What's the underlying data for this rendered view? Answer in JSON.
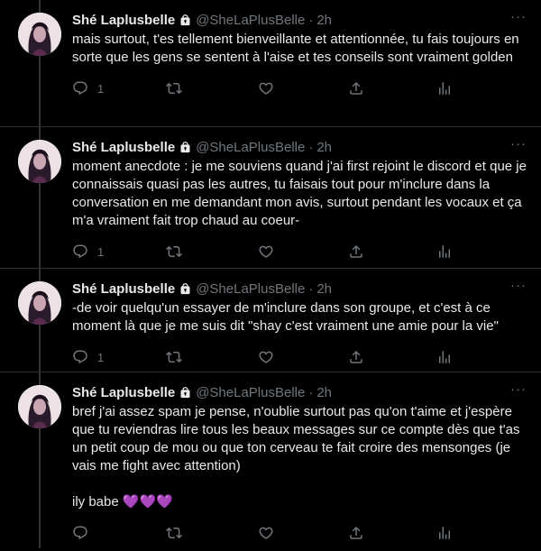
{
  "author": {
    "name": "Shé Laplusbelle",
    "handle": "@SheLaPlusBelle"
  },
  "tweets": [
    {
      "time": "2h",
      "text": "mais surtout, t'es tellement bienveillante et attentionnée, tu fais toujours en sorte que les gens se sentent à l'aise et tes conseils sont vraiment golden",
      "reply_count": "1"
    },
    {
      "time": "2h",
      "text": "moment anecdote : je me souviens quand j'ai first rejoint le discord et que je connaissais quasi pas les autres, tu faisais tout pour m'inclure dans la conversation en me demandant mon avis, surtout pendant les vocaux et ça m'a vraiment fait trop chaud au coeur-",
      "reply_count": "1"
    },
    {
      "time": "2h",
      "text": "-de voir quelqu'un essayer de m'inclure dans son groupe, et c'est à ce moment là que je me suis dit \"shay c'est vraiment une amie pour la vie\"",
      "reply_count": "1"
    },
    {
      "time": "2h",
      "text": "bref j'ai assez spam je pense, n'oublie surtout pas qu'on t'aime et j'espère que tu reviendras lire tous les beaux messages sur ce compte dès que t'as un petit coup de mou ou que ton cerveau te fait croire des mensonges (je vais me fight avec attention)\n\nily babe 💜💜💜",
      "reply_count": ""
    }
  ],
  "colors": {
    "background": "#000000",
    "text": "#e7e9ea",
    "muted": "#71767b",
    "divider": "#2f3336"
  },
  "icons": [
    "lock-icon",
    "more-icon",
    "reply-icon",
    "retweet-icon",
    "like-icon",
    "share-icon",
    "analytics-icon"
  ]
}
